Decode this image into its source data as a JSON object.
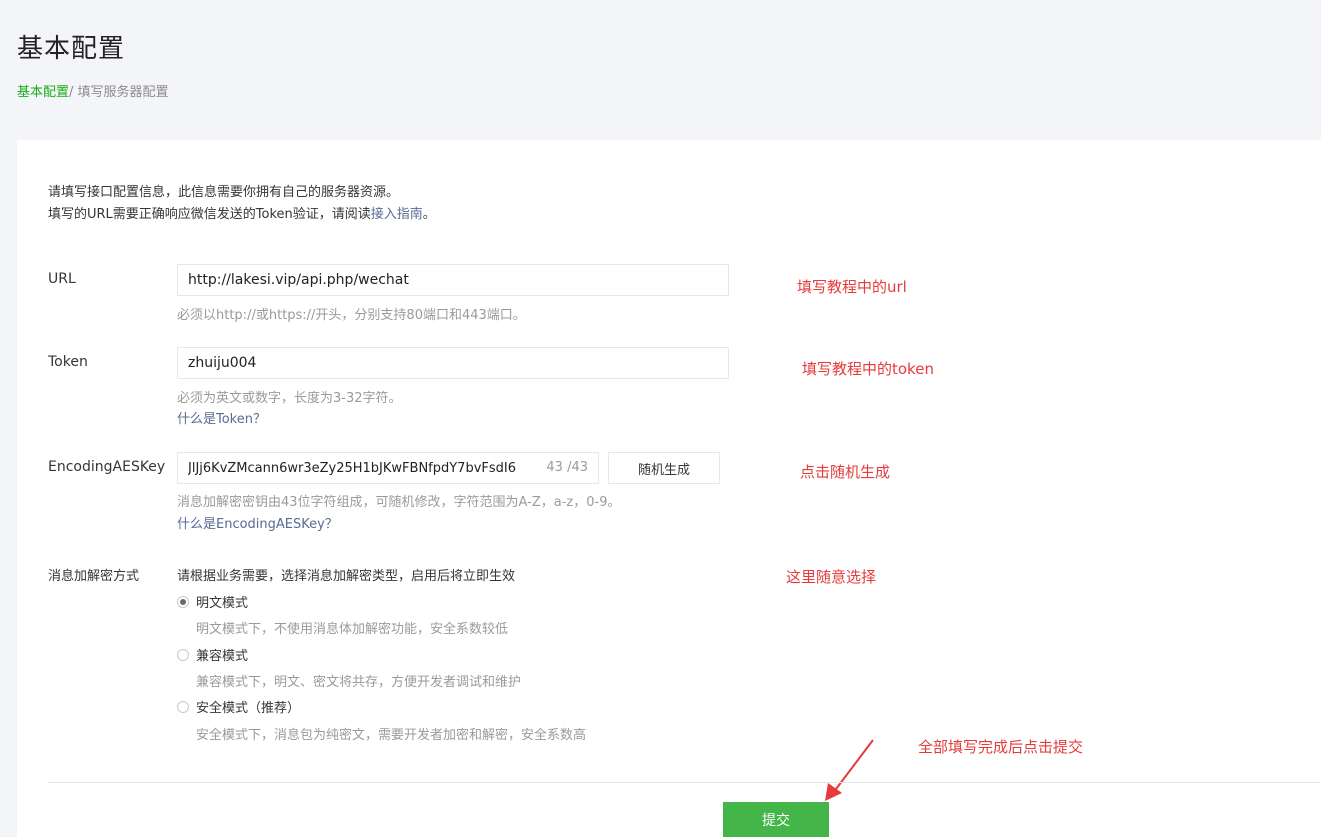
{
  "page": {
    "title": "基本配置"
  },
  "breadcrumb": {
    "link": "基本配置",
    "separator": "/",
    "current": " 填写服务器配置"
  },
  "intro": {
    "line1": "请填写接口配置信息，此信息需要你拥有自己的服务器资源。",
    "line2_prefix": "填写的URL需要正确响应微信发送的Token验证，请阅读",
    "line2_link": "接入指南",
    "line2_suffix": "。"
  },
  "url": {
    "label": "URL",
    "value": "http://lakesi.vip/api.php/wechat",
    "tip": "必须以http://或https://开头，分别支持80端口和443端口。",
    "annotation": "填写教程中的url"
  },
  "token": {
    "label": "Token",
    "value": "zhuiju004",
    "tip": "必须为英文或数字，长度为3-32字符。",
    "help": "什么是Token？",
    "annotation": "填写教程中的token"
  },
  "aes": {
    "label": "EncodingAESKey",
    "value": "JlJj6KvZMcann6wr3eZy25H1bJKwFBNfpdY7bvFsdI6",
    "count": "43 /43",
    "button": "随机生成",
    "tip": "消息加解密密钥由43位字符组成，可随机修改，字符范围为A-Z，a-z，0-9。",
    "help": "什么是EncodingAESKey？",
    "annotation": "点击随机生成"
  },
  "mode": {
    "label": "消息加解密方式",
    "desc": "请根据业务需要，选择消息加解密类型，启用后将立即生效",
    "annotation": "这里随意选择",
    "options": [
      {
        "label": "明文模式",
        "desc": "明文模式下，不使用消息体加解密功能，安全系数较低",
        "checked": true
      },
      {
        "label": "兼容模式",
        "desc": "兼容模式下，明文、密文将共存，方便开发者调试和维护",
        "checked": false
      },
      {
        "label": "安全模式（推荐）",
        "desc": "安全模式下，消息包为纯密文，需要开发者加密和解密，安全系数高",
        "checked": false
      }
    ]
  },
  "submit": {
    "label": "提交",
    "annotation": "全部填写完成后点击提交"
  },
  "colors": {
    "accent": "#44b549",
    "link": "#576b95",
    "annotation": "#e53b3b"
  }
}
